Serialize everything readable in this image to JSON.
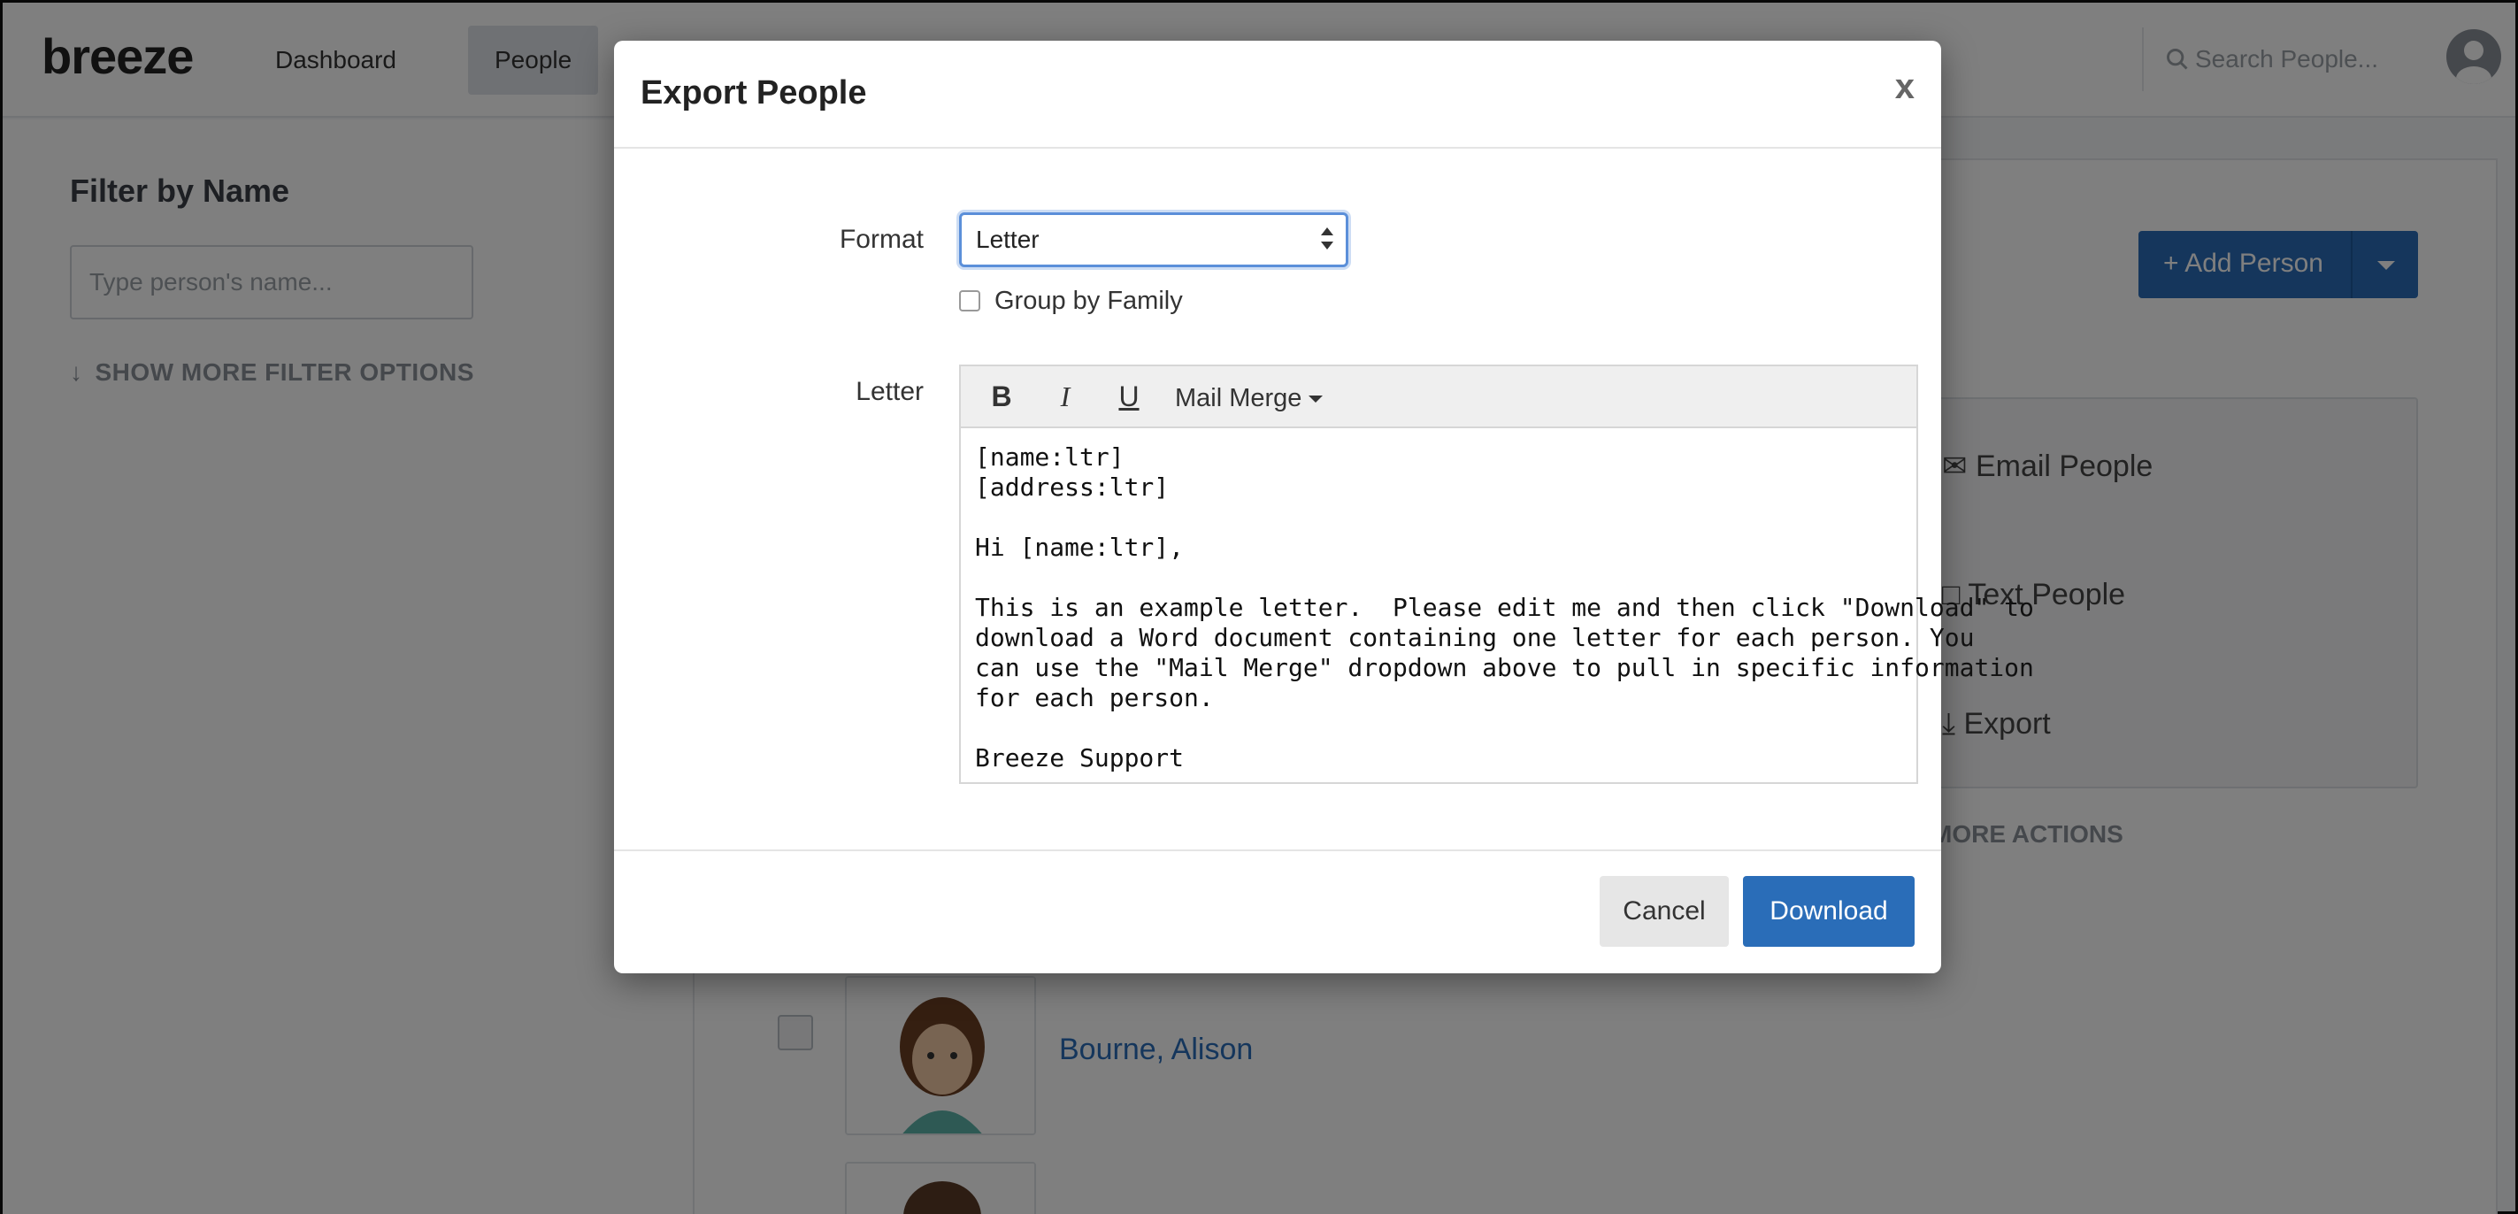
{
  "app": {
    "logo": "breeze",
    "nav": {
      "dashboard": "Dashboard",
      "people": "People"
    },
    "search_placeholder": "Search People..."
  },
  "sidebar": {
    "filter_title": "Filter by Name",
    "filter_placeholder": "Type person's name...",
    "more_filters": "SHOW MORE FILTER OPTIONS"
  },
  "main": {
    "add_person": "Add Person",
    "actions": [
      "Email People",
      "Text People",
      "Export"
    ],
    "more_actions": "MORE ACTIONS",
    "people": [
      "Bourne, Alison"
    ]
  },
  "modal": {
    "title": "Export People",
    "close": "x",
    "format_label": "Format",
    "format_value": "Letter",
    "group_by_family": "Group by Family",
    "letter_label": "Letter",
    "toolbar": {
      "bold": "B",
      "italic": "I",
      "underline": "U",
      "mail_merge": "Mail Merge"
    },
    "letter_lines": [
      "[name:ltr]",
      "[address:ltr]",
      "",
      "Hi [name:ltr],",
      "",
      "This is an example letter.  Please edit me and then click \"Download\" to",
      "download a Word document containing one letter for each person. You",
      "can use the \"Mail Merge\" dropdown above to pull in specific information",
      "for each person.",
      "",
      "Breeze Support"
    ],
    "cancel": "Cancel",
    "download": "Download"
  },
  "colors": {
    "accent": "#2a6db8",
    "overlay": "rgba(0,0,0,0.5)"
  }
}
